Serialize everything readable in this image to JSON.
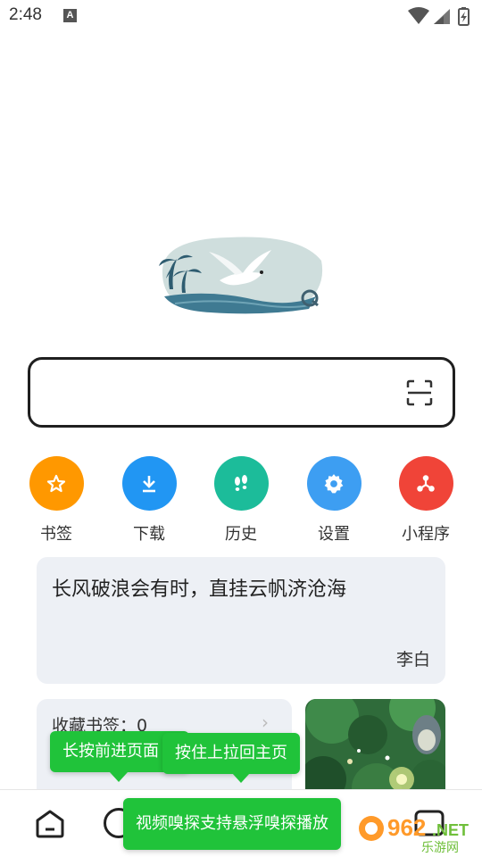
{
  "status_bar": {
    "time": "2:48",
    "notification_letter": "A",
    "icons": [
      "wifi-icon",
      "cell-signal-icon",
      "battery-charging-icon"
    ]
  },
  "search": {
    "value": "",
    "placeholder": "",
    "scan_icon": "scan-icon"
  },
  "shortcuts": [
    {
      "label": "书签",
      "icon": "star-icon",
      "color": "#ff9800"
    },
    {
      "label": "下载",
      "icon": "download-icon",
      "color": "#2196f3"
    },
    {
      "label": "历史",
      "icon": "footprints-icon",
      "color": "#1cbc9a"
    },
    {
      "label": "设置",
      "icon": "gear-icon",
      "color": "#3d9ef2"
    },
    {
      "label": "小程序",
      "icon": "mini-program-icon",
      "color": "#f04438"
    }
  ],
  "quote": {
    "text": "长风破浪会有时，直挂云帆济沧海",
    "author": "李白"
  },
  "bookmark_card": {
    "title": "收藏书签：0",
    "chevron": "›"
  },
  "tooltips": {
    "forward": "长按前进页面",
    "pull_up": "按住上拉回主页",
    "sniff": "视频嗅探支持悬浮嗅探播放"
  },
  "bottom_nav": {
    "icons": [
      "home-icon",
      "circle-icon",
      "tabs-icon"
    ]
  },
  "watermark": {
    "number": "962",
    "suffix": ".NET",
    "text": "乐游网"
  },
  "colors": {
    "tooltip_green": "#20c33a",
    "card_bg": "#edf0f5",
    "search_border": "#1f1f1f"
  }
}
